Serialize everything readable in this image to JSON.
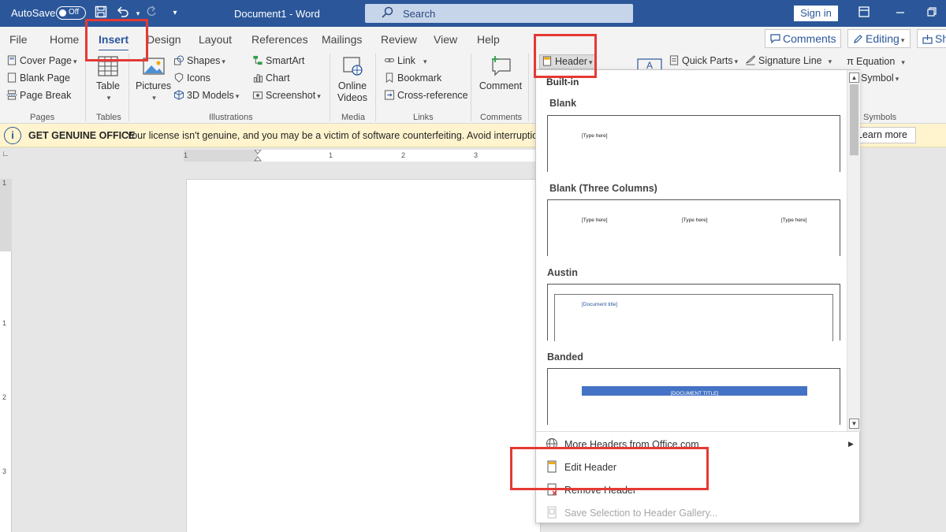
{
  "titlebar": {
    "autosave_label": "AutoSave",
    "autosave_state": "Off",
    "document_title": "Document1  -  Word",
    "search_label": "Search",
    "signin_label": "Sign in",
    "icons": [
      "save-icon",
      "undo-icon",
      "redo-icon",
      "customize-icon",
      "ribbon-display-icon",
      "minimize-icon",
      "restore-icon"
    ]
  },
  "tabs": [
    "File",
    "Home",
    "Insert",
    "Design",
    "Layout",
    "References",
    "Mailings",
    "Review",
    "View",
    "Help"
  ],
  "active_tab": "Insert",
  "header_buttons": {
    "comments": "Comments",
    "editing": "Editing",
    "share": "Sh"
  },
  "ribbon": {
    "pages": {
      "cover_page": "Cover Page",
      "blank_page": "Blank Page",
      "page_break": "Page Break",
      "group": "Pages"
    },
    "tables": {
      "table": "Table",
      "group": "Tables"
    },
    "illustrations": {
      "pictures": "Pictures",
      "shapes": "Shapes",
      "icons": "Icons",
      "models": "3D Models",
      "smartart": "SmartArt",
      "chart": "Chart",
      "screenshot": "Screenshot",
      "group": "Illustrations"
    },
    "media": {
      "online_videos_1": "Online",
      "online_videos_2": "Videos",
      "group": "Media"
    },
    "links": {
      "link": "Link",
      "bookmark": "Bookmark",
      "cross_reference": "Cross-reference",
      "group": "Links"
    },
    "comments": {
      "comment": "Comment",
      "group": "Comments"
    },
    "header_footer": {
      "header": "Header"
    },
    "text": {
      "quick_parts": "Quick Parts",
      "signature_line": "Signature Line"
    },
    "symbols": {
      "equation": "Equation",
      "symbol": "Symbol",
      "group": "Symbols"
    }
  },
  "notice": {
    "title": "GET GENUINE OFFICE",
    "message": "Your license isn't genuine, and you may be a victim of software counterfeiting. Avoid interruption and",
    "button": "Learn more"
  },
  "ruler": {
    "h_marks": [
      "1",
      "1",
      "2",
      "3"
    ],
    "v_marks": [
      "1",
      "1",
      "2",
      "3"
    ]
  },
  "header_dropdown": {
    "section_label": "Built-in",
    "gallery": [
      {
        "name": "Blank",
        "placeholders": [
          "[Type here]"
        ]
      },
      {
        "name": "Blank (Three Columns)",
        "placeholders": [
          "[Type here]",
          "[Type here]",
          "[Type here]"
        ]
      },
      {
        "name": "Austin",
        "placeholders": [
          "[Document title]"
        ]
      },
      {
        "name": "Banded",
        "placeholders": [
          "[DOCUMENT TITLE]"
        ]
      }
    ],
    "menu": {
      "more_headers": "More Headers from Office.com",
      "edit_header": "Edit Header",
      "remove_header": "Remove Header",
      "save_selection": "Save Selection to Header Gallery..."
    }
  },
  "colors": {
    "accent": "#2b579a",
    "highlight": "#e53935",
    "notice_bg": "#fff4ce",
    "banded": "#4472c4"
  }
}
